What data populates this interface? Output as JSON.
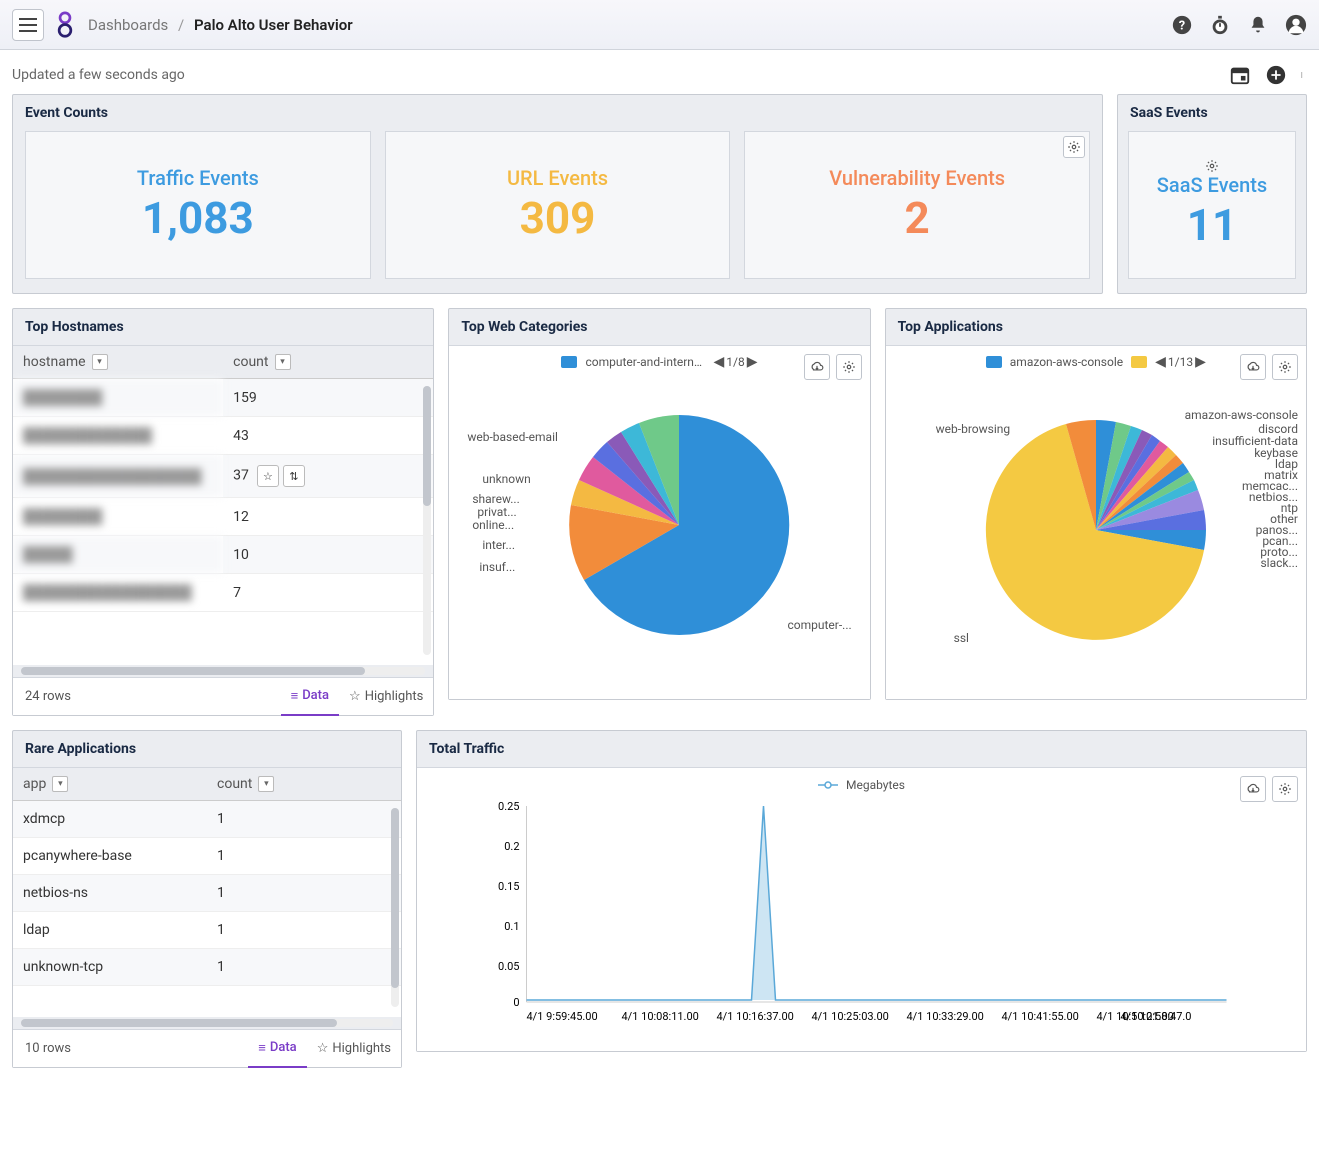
{
  "header": {
    "breadcrumb_root": "Dashboards",
    "breadcrumb_current": "Palo Alto User Behavior"
  },
  "subheader": {
    "updated": "Updated a few seconds ago"
  },
  "event_counts": {
    "title": "Event Counts",
    "cards": [
      {
        "label": "Traffic Events",
        "value": "1,083",
        "color": "c-blue"
      },
      {
        "label": "URL Events",
        "value": "309",
        "color": "c-gold"
      },
      {
        "label": "Vulnerability Events",
        "value": "2",
        "color": "c-orange"
      }
    ]
  },
  "saas": {
    "title": "SaaS Events",
    "label": "SaaS Events",
    "value": "11"
  },
  "top_hostnames": {
    "title": "Top Hostnames",
    "columns": [
      "hostname",
      "count"
    ],
    "rows": [
      {
        "hostname": "████████",
        "count": "159"
      },
      {
        "hostname": "█████████████",
        "count": "43"
      },
      {
        "hostname": "██████████████████",
        "count": "37",
        "actions": true
      },
      {
        "hostname": "████████",
        "count": "12"
      },
      {
        "hostname": "█████",
        "count": "10"
      },
      {
        "hostname": "█████████████████",
        "count": "7"
      }
    ],
    "footer_count": "24 rows",
    "tab_data": "Data",
    "tab_highlights": "Highlights"
  },
  "top_web_categories": {
    "title": "Top Web Categories",
    "legend_current": "computer-and-internet-info",
    "pager": "1/8",
    "labels": [
      "web-based-email",
      "unknown",
      "sharew...",
      "privat...",
      "online...",
      "inter...",
      "insuf...",
      "computer-..."
    ]
  },
  "top_applications": {
    "title": "Top Applications",
    "legend_current": "amazon-aws-console",
    "pager": "1/13",
    "labels": [
      "web-browsing",
      "ssl",
      "amazon-aws-console",
      "discord",
      "insufficient-data",
      "keybase",
      "ldap",
      "matrix",
      "memcac...",
      "netbios...",
      "ntp",
      "other",
      "panos...",
      "pcan...",
      "proto...",
      "slack..."
    ]
  },
  "rare_applications": {
    "title": "Rare Applications",
    "columns": [
      "app",
      "count"
    ],
    "rows": [
      {
        "app": "xdmcp",
        "count": "1"
      },
      {
        "app": "pcanywhere-base",
        "count": "1"
      },
      {
        "app": "netbios-ns",
        "count": "1"
      },
      {
        "app": "ldap",
        "count": "1"
      },
      {
        "app": "unknown-tcp",
        "count": "1"
      }
    ],
    "footer_count": "10 rows",
    "tab_data": "Data",
    "tab_highlights": "Highlights"
  },
  "total_traffic": {
    "title": "Total Traffic",
    "legend": "Megabytes",
    "y_ticks": [
      "0.25",
      "0.2",
      "0.15",
      "0.1",
      "0.05",
      "0"
    ],
    "x_ticks": [
      "4/1 9:59:45.00",
      "4/1 10:08:11.00",
      "4/1 10:16:37.00",
      "4/1 10:25:03.00",
      "4/1 10:33:29.00",
      "4/1 10:41:55.00",
      "4/1 10:50:21.00",
      "4/1 10:58:47.0"
    ]
  },
  "chart_data": [
    {
      "type": "pie",
      "title": "Top Web Categories",
      "series": [
        {
          "name": "computer-and-internet-info",
          "value": 62
        },
        {
          "name": "web-based-email",
          "value": 14
        },
        {
          "name": "unknown",
          "value": 4
        },
        {
          "name": "shareware",
          "value": 3
        },
        {
          "name": "private",
          "value": 3
        },
        {
          "name": "online",
          "value": 3
        },
        {
          "name": "internet",
          "value": 5
        },
        {
          "name": "insufficient-data",
          "value": 6
        }
      ]
    },
    {
      "type": "pie",
      "title": "Top Applications",
      "series": [
        {
          "name": "ssl",
          "value": 68
        },
        {
          "name": "web-browsing",
          "value": 5
        },
        {
          "name": "amazon-aws-console",
          "value": 6
        },
        {
          "name": "discord",
          "value": 1
        },
        {
          "name": "insufficient-data",
          "value": 1
        },
        {
          "name": "keybase",
          "value": 1
        },
        {
          "name": "ldap",
          "value": 1
        },
        {
          "name": "matrix",
          "value": 1
        },
        {
          "name": "memcached",
          "value": 1
        },
        {
          "name": "netbios",
          "value": 1
        },
        {
          "name": "ntp",
          "value": 1
        },
        {
          "name": "other",
          "value": 3
        },
        {
          "name": "panos",
          "value": 2
        },
        {
          "name": "pcanywhere",
          "value": 1
        },
        {
          "name": "protobuf",
          "value": 4
        },
        {
          "name": "slack",
          "value": 3
        }
      ]
    },
    {
      "type": "line",
      "title": "Total Traffic",
      "ylabel": "Megabytes",
      "ylim": [
        0,
        0.25
      ],
      "x": [
        "4/1 9:59:45",
        "4/1 10:08:11",
        "4/1 10:16:37",
        "4/1 10:19:00",
        "4/1 10:20:30",
        "4/1 10:25:03",
        "4/1 10:33:29",
        "4/1 10:41:55",
        "4/1 10:50:21",
        "4/1 10:58:47"
      ],
      "series": [
        {
          "name": "Megabytes",
          "values": [
            0.005,
            0.004,
            0.003,
            0.25,
            0.003,
            0.004,
            0.003,
            0.004,
            0.003,
            0.004
          ]
        }
      ]
    }
  ]
}
